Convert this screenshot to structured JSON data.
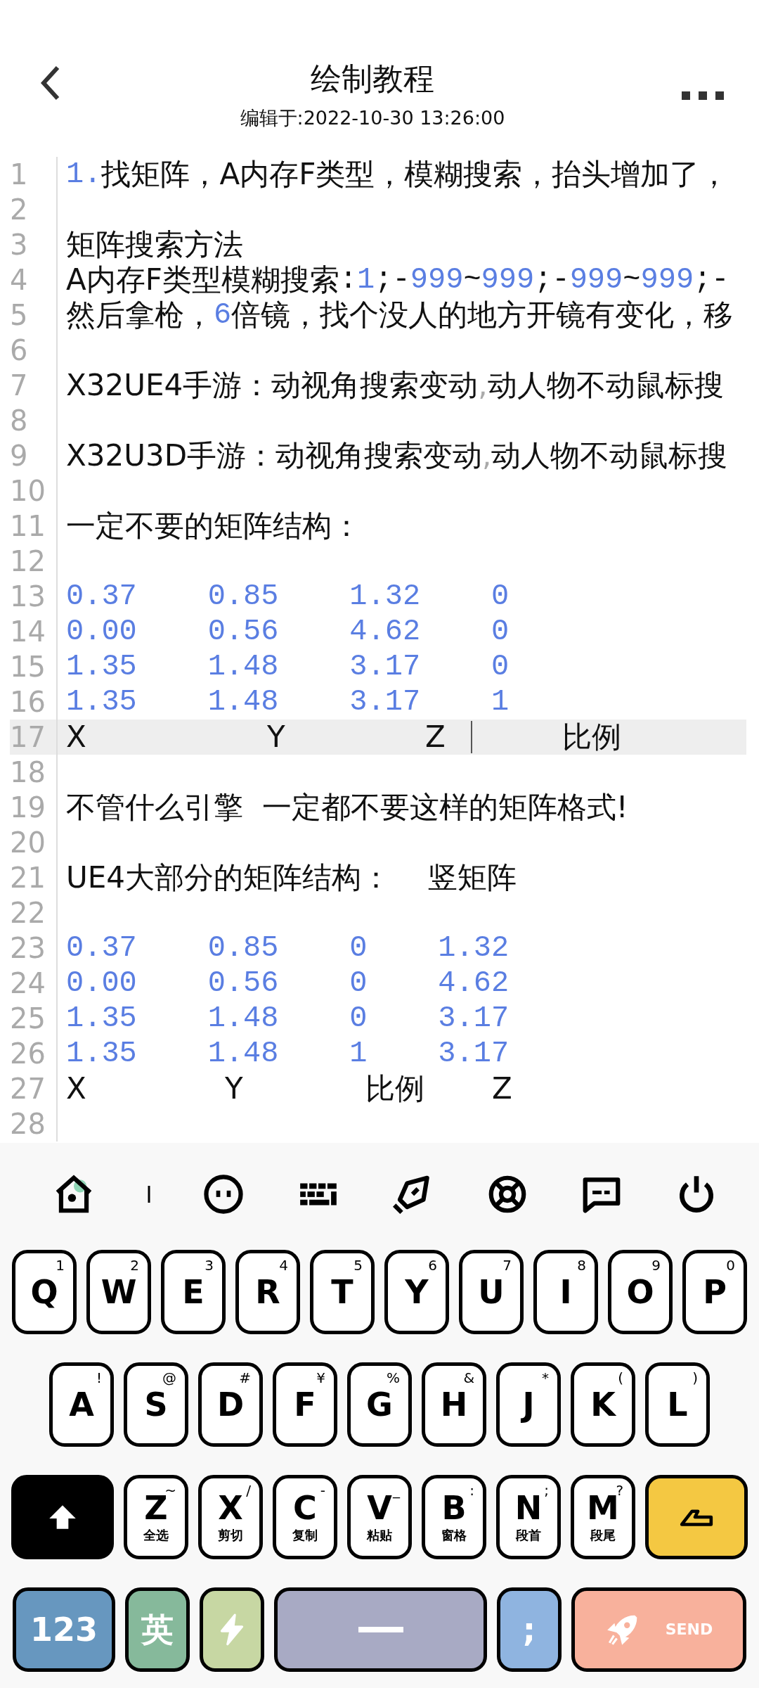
{
  "header": {
    "title": "绘制教程",
    "subtitle": "编辑于:2022-10-30 13:26:00"
  },
  "editor": {
    "lines": [
      {
        "number": "1",
        "kind": "text",
        "selected": false,
        "runs": [
          {
            "text": "1.",
            "kind": "number"
          },
          {
            "text": "找矩阵，A内存F类型，模糊搜索，抬头增加了，",
            "kind": "plain"
          }
        ]
      },
      {
        "number": "2",
        "kind": "text",
        "selected": false
      },
      {
        "number": "3",
        "kind": "text",
        "selected": false,
        "runs": [
          {
            "text": "矩阵搜索方法",
            "kind": "plain"
          }
        ]
      },
      {
        "number": "4",
        "kind": "text",
        "selected": false,
        "runs": [
          {
            "text": "A内存F类型模糊搜索",
            "kind": "plain"
          },
          {
            "text": ":",
            "kind": "symbol"
          },
          {
            "text": "1",
            "kind": "number"
          },
          {
            "text": ";-",
            "kind": "symbol"
          },
          {
            "text": "999",
            "kind": "number"
          },
          {
            "text": "~",
            "kind": "symbol"
          },
          {
            "text": "999",
            "kind": "number"
          },
          {
            "text": ";-",
            "kind": "symbol"
          },
          {
            "text": "999",
            "kind": "number"
          },
          {
            "text": "~",
            "kind": "symbol"
          },
          {
            "text": "999",
            "kind": "number"
          },
          {
            "text": ";-",
            "kind": "symbol"
          }
        ]
      },
      {
        "number": "5",
        "kind": "text",
        "selected": false,
        "runs": [
          {
            "text": "然后拿枪，",
            "kind": "plain"
          },
          {
            "text": "6",
            "kind": "number"
          },
          {
            "text": "倍镜，找个没人的地方开镜有变化，移",
            "kind": "plain"
          }
        ]
      },
      {
        "number": "6",
        "kind": "text",
        "selected": false
      },
      {
        "number": "7",
        "kind": "text",
        "selected": false,
        "runs": [
          {
            "text": "X32UE4手游：动视角搜索变动",
            "kind": "plain"
          },
          {
            "text": ",",
            "kind": "punct"
          },
          {
            "text": "动人物不动鼠标搜",
            "kind": "plain"
          }
        ]
      },
      {
        "number": "8",
        "kind": "text",
        "selected": false
      },
      {
        "number": "9",
        "kind": "text",
        "selected": false,
        "runs": [
          {
            "text": "X32U3D手游：动视角搜索变动",
            "kind": "plain"
          },
          {
            "text": ",",
            "kind": "punct"
          },
          {
            "text": "动人物不动鼠标搜",
            "kind": "plain"
          }
        ]
      },
      {
        "number": "10",
        "kind": "text",
        "selected": false
      },
      {
        "number": "11",
        "kind": "text",
        "selected": false,
        "runs": [
          {
            "text": "一定不要的矩阵结构：",
            "kind": "plain"
          }
        ]
      },
      {
        "number": "12",
        "kind": "text",
        "selected": false
      },
      {
        "number": "13",
        "kind": "text",
        "selected": false,
        "runs": [
          {
            "text": "0.37    0.85    1.32    0",
            "kind": "number"
          }
        ]
      },
      {
        "number": "14",
        "kind": "text",
        "selected": false,
        "runs": [
          {
            "text": "0.00    0.56    4.62    0",
            "kind": "number"
          }
        ]
      },
      {
        "number": "15",
        "kind": "text",
        "selected": false,
        "runs": [
          {
            "text": "1.35    1.48    3.17    0",
            "kind": "number"
          }
        ]
      },
      {
        "number": "16",
        "kind": "text",
        "selected": false,
        "runs": [
          {
            "text": "1.35    1.48    3.17    1",
            "kind": "number"
          }
        ]
      },
      {
        "number": "17",
        "kind": "axes-a",
        "selected": true,
        "cells": [
          {
            "text": "X",
            "cursor": false
          },
          {
            "text": "Y",
            "cursor": false
          },
          {
            "text": "Z",
            "cursor": true
          },
          {
            "text": "比例",
            "cursor": false
          }
        ]
      },
      {
        "number": "18",
        "kind": "text",
        "selected": false
      },
      {
        "number": "19",
        "kind": "text",
        "selected": false,
        "runs": [
          {
            "text": "不管什么引擎  一定都不要这样的矩阵格式!",
            "kind": "plain"
          }
        ]
      },
      {
        "number": "20",
        "kind": "text",
        "selected": false
      },
      {
        "number": "21",
        "kind": "text",
        "selected": false,
        "runs": [
          {
            "text": "UE4大部分的矩阵结构：    竖矩阵",
            "kind": "plain"
          }
        ]
      },
      {
        "number": "22",
        "kind": "text",
        "selected": false
      },
      {
        "number": "23",
        "kind": "text",
        "selected": false,
        "runs": [
          {
            "text": "0.37    0.85    0    1.32",
            "kind": "number"
          }
        ]
      },
      {
        "number": "24",
        "kind": "text",
        "selected": false,
        "runs": [
          {
            "text": "0.00    0.56    0    4.62",
            "kind": "number"
          }
        ]
      },
      {
        "number": "25",
        "kind": "text",
        "selected": false,
        "runs": [
          {
            "text": "1.35    1.48    0    3.17",
            "kind": "number"
          }
        ]
      },
      {
        "number": "26",
        "kind": "text",
        "selected": false,
        "runs": [
          {
            "text": "1.35    1.48    1    3.17",
            "kind": "number"
          }
        ]
      },
      {
        "number": "27",
        "kind": "axes-b",
        "selected": false,
        "cells": [
          {
            "text": "X",
            "cursor": false
          },
          {
            "text": "Y",
            "cursor": false
          },
          {
            "text": "比例",
            "cursor": false
          },
          {
            "text": "Z",
            "cursor": false
          }
        ]
      },
      {
        "number": "28",
        "kind": "text",
        "selected": false
      }
    ]
  },
  "keyboard": {
    "rows": [
      {
        "keys": [
          {
            "kind": "letter",
            "label": "Q",
            "hint": "1"
          },
          {
            "kind": "letter",
            "label": "W",
            "hint": "2"
          },
          {
            "kind": "letter",
            "label": "E",
            "hint": "3"
          },
          {
            "kind": "letter",
            "label": "R",
            "hint": "4"
          },
          {
            "kind": "letter",
            "label": "T",
            "hint": "5"
          },
          {
            "kind": "letter",
            "label": "Y",
            "hint": "6"
          },
          {
            "kind": "letter",
            "label": "U",
            "hint": "7"
          },
          {
            "kind": "letter",
            "label": "I",
            "hint": "8"
          },
          {
            "kind": "letter",
            "label": "O",
            "hint": "9"
          },
          {
            "kind": "letter",
            "label": "P",
            "hint": "0"
          }
        ]
      },
      {
        "keys": [
          {
            "kind": "letter",
            "label": "A",
            "hint": "!"
          },
          {
            "kind": "letter",
            "label": "S",
            "hint": "@"
          },
          {
            "kind": "letter",
            "label": "D",
            "hint": "#"
          },
          {
            "kind": "letter",
            "label": "F",
            "hint": "¥"
          },
          {
            "kind": "letter",
            "label": "G",
            "hint": "%"
          },
          {
            "kind": "letter",
            "label": "H",
            "hint": "&"
          },
          {
            "kind": "letter",
            "label": "J",
            "hint": "*"
          },
          {
            "kind": "letter",
            "label": "K",
            "hint": "("
          },
          {
            "kind": "letter",
            "label": "L",
            "hint": ")"
          }
        ]
      },
      {
        "keys": [
          {
            "kind": "shift",
            "color": "#000000"
          },
          {
            "kind": "letter",
            "label": "Z",
            "hint": "~",
            "caption": "全选"
          },
          {
            "kind": "letter",
            "label": "X",
            "hint": "/",
            "caption": "剪切"
          },
          {
            "kind": "letter",
            "label": "C",
            "hint": "-",
            "caption": "复制"
          },
          {
            "kind": "letter",
            "label": "V",
            "hint": "_",
            "caption": "粘贴"
          },
          {
            "kind": "letter",
            "label": "B",
            "hint": ":",
            "caption": "窗格"
          },
          {
            "kind": "letter",
            "label": "N",
            "hint": ";",
            "caption": "段首"
          },
          {
            "kind": "letter",
            "label": "M",
            "hint": "?",
            "caption": "段尾"
          },
          {
            "kind": "enter",
            "color": "#f4c842"
          }
        ]
      },
      {
        "keys": [
          {
            "kind": "num",
            "label": "123",
            "color": "#6797bf"
          },
          {
            "kind": "lang",
            "label": "英",
            "color": "#86b99b"
          },
          {
            "kind": "bolt",
            "color": "#c7d7a3"
          },
          {
            "kind": "space",
            "color": "#a8aac4"
          },
          {
            "kind": "symbol",
            "label": ";",
            "color": "#8fb4e0"
          },
          {
            "kind": "send",
            "label": "SEND",
            "color": "#f8b19c"
          }
        ]
      }
    ]
  }
}
